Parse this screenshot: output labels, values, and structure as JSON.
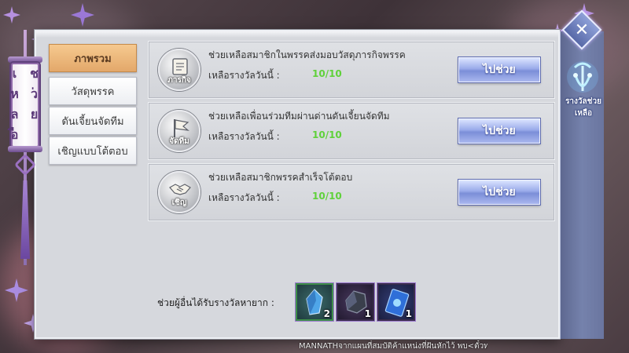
{
  "window": {
    "banner_title": "ช่วยเหลือ",
    "close_icon": "close-icon"
  },
  "tabs": [
    {
      "label": "ภาพรวม",
      "active": true
    },
    {
      "label": "วัสดุพรรค",
      "active": false
    },
    {
      "label": "ดันเจี้ยนจัดทีม",
      "active": false
    },
    {
      "label": "เชิญแบบโต้ตอบ",
      "active": false
    }
  ],
  "quests": [
    {
      "icon": "scroll-icon",
      "emblem_label": "ภารกิจ",
      "title": "ช่วยเหลือสมาชิกในพรรคส่งมอบวัสดุภารกิจพรรค",
      "reward_label": "เหลือรางวัลวันนี้ :",
      "reward_value": "10/10",
      "button_label": "ไปช่วย"
    },
    {
      "icon": "flag-icon",
      "emblem_label": "จัดทีม",
      "title": "ช่วยเหลือเพื่อนร่วมทีมผ่านด่านดันเจี้ยนจัดทีม",
      "reward_label": "เหลือรางวัลวันนี้ :",
      "reward_value": "10/10",
      "button_label": "ไปช่วย"
    },
    {
      "icon": "handshake-icon",
      "emblem_label": "เชิญ",
      "title": "ช่วยเหลือสมาชิกพรรคสำเร็จโต้ตอบ",
      "reward_label": "เหลือรางวัลวันนี้ :",
      "reward_value": "10/10",
      "button_label": "ไปช่วย"
    }
  ],
  "rare_rewards": {
    "label": "ช่วยผู้อื่นได้รับรางวัลหายาก :",
    "items": [
      {
        "icon": "blue-crystal-icon",
        "qty": "2",
        "border": "#3f8f4a"
      },
      {
        "icon": "dark-ore-icon",
        "qty": "1",
        "border": "#7a4fb0"
      },
      {
        "icon": "blue-card-icon",
        "qty": "1",
        "border": "#7a4fb0"
      }
    ]
  },
  "side_panel": {
    "help_reward_label": "รางวัลช่วยเหลือ"
  },
  "ticker": {
    "text": "MANNATHจากแผนที่สมบัติค้าแหน่งที่ฝันหักไว้ พบ<ตั๋วทอง"
  },
  "colors": {
    "tab_active": "#e3a86a",
    "reward_value": "#5fd13a",
    "button": "#7b8ed8",
    "panel": "#d6d8dd"
  }
}
